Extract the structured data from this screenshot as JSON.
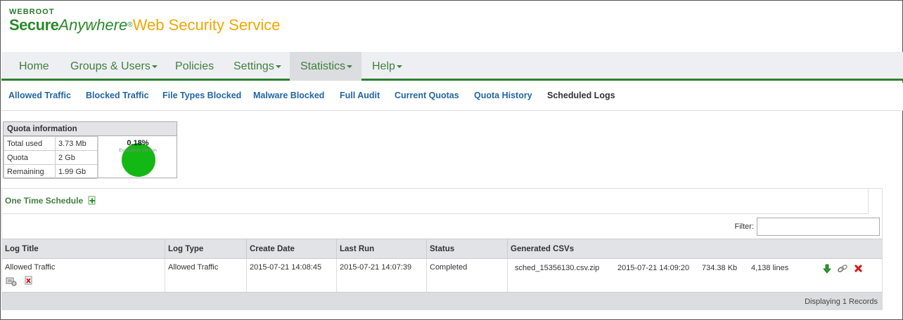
{
  "brand": {
    "top": "WEBROOT",
    "secure": "Secure",
    "anywhere": "Anywhere",
    "reg": "®",
    "service": "Web Security Service"
  },
  "nav": {
    "items": [
      {
        "label": "Home"
      },
      {
        "label": "Groups & Users"
      },
      {
        "label": "Policies"
      },
      {
        "label": "Settings"
      },
      {
        "label": "Statistics"
      },
      {
        "label": "Help"
      }
    ]
  },
  "subnav": {
    "items": [
      {
        "label": "Allowed Traffic"
      },
      {
        "label": "Blocked Traffic"
      },
      {
        "label": "File Types Blocked"
      },
      {
        "label": "Malware Blocked"
      },
      {
        "label": "Full Audit"
      },
      {
        "label": "Current Quotas"
      },
      {
        "label": "Quota History"
      },
      {
        "label": "Scheduled Logs"
      }
    ]
  },
  "quota": {
    "title": "Quota information",
    "rows": [
      {
        "label": "Total used",
        "value": "3.73 Mb"
      },
      {
        "label": "Quota",
        "value": "2 Gb"
      },
      {
        "label": "Remaining",
        "value": "1.99 Gb"
      }
    ],
    "percent": "0.18%",
    "eval_text": "Evaluation Version",
    "gauge_color": "#14b814"
  },
  "schedule": {
    "title": "One Time Schedule",
    "filter_label": "Filter:",
    "filter_value": "",
    "columns": [
      "Log Title",
      "Log Type",
      "Create Date",
      "Last Run",
      "Status",
      "Generated CSVs"
    ],
    "rows": [
      {
        "log_title": "Allowed Traffic",
        "log_type": "Allowed Traffic",
        "create_date": "2015-07-21 14:08:45",
        "last_run": "2015-07-21 14:07:39",
        "status": "Completed",
        "csv": {
          "file": "sched_15356130.csv.zip",
          "date": "2015-07-21 14:09:20",
          "size": "734.38 Kb",
          "lines": "4,138 lines"
        }
      }
    ],
    "footer": "Displaying 1 Records"
  },
  "colors": {
    "accent_green": "#2f7f2f",
    "link_blue": "#2167a8",
    "brand_orange": "#f0a800"
  }
}
